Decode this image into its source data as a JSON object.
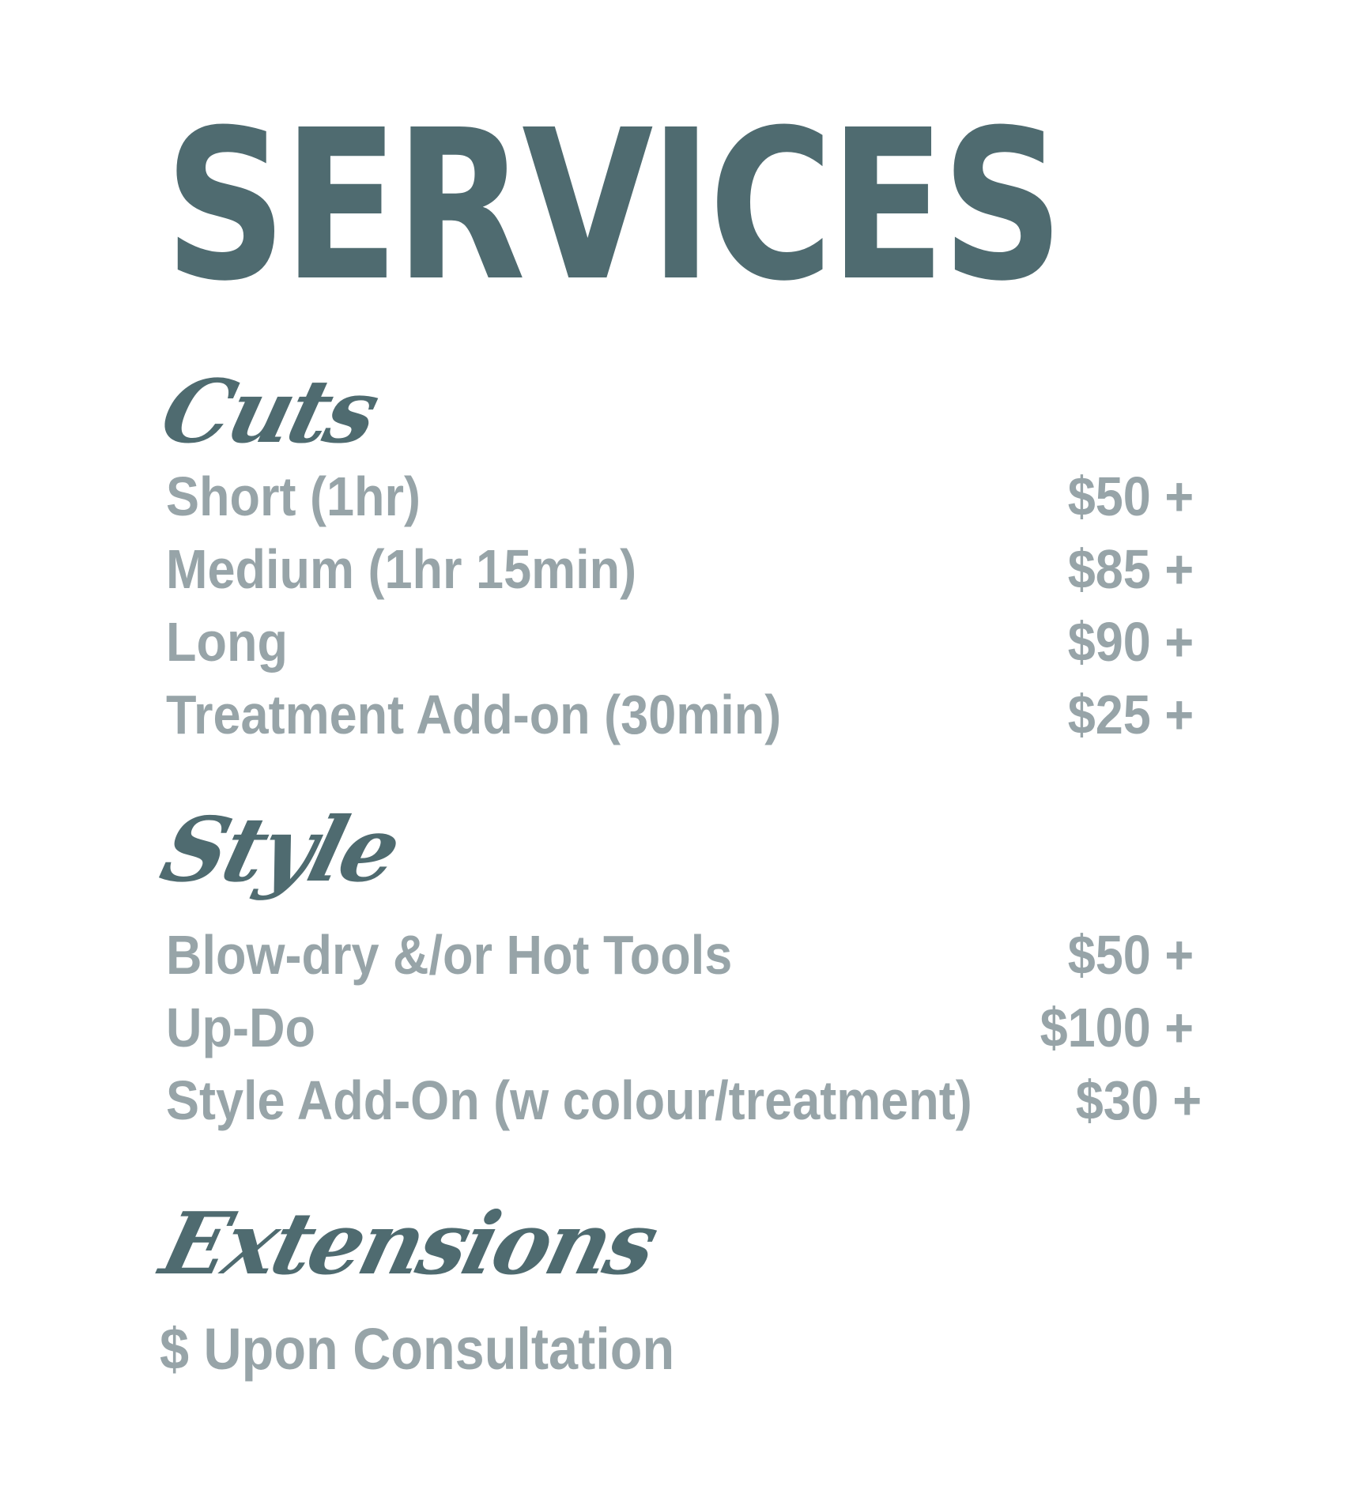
{
  "title": "SERVICES",
  "colors": {
    "accent": "#4f6b70",
    "muted": "#97a4a8",
    "background": "#ffffff"
  },
  "sections": {
    "cuts": {
      "heading": "Cuts",
      "items": [
        {
          "name": "Short (1hr)",
          "price": "$50 +"
        },
        {
          "name": "Medium (1hr 15min)",
          "price": "$85 +"
        },
        {
          "name": "Long",
          "price": "$90 +"
        },
        {
          "name": "Treatment Add-on (30min)",
          "price": "$25 +"
        }
      ]
    },
    "style": {
      "heading": "Style",
      "items": [
        {
          "name": "Blow-dry &/or Hot Tools",
          "price": "$50 +"
        },
        {
          "name": "Up-Do",
          "price": "$100 +"
        },
        {
          "name": "Style Add-On (w colour/treatment)",
          "price": "$30 +"
        }
      ]
    },
    "extensions": {
      "heading": "Extensions",
      "note": "$ Upon Consultation"
    }
  }
}
